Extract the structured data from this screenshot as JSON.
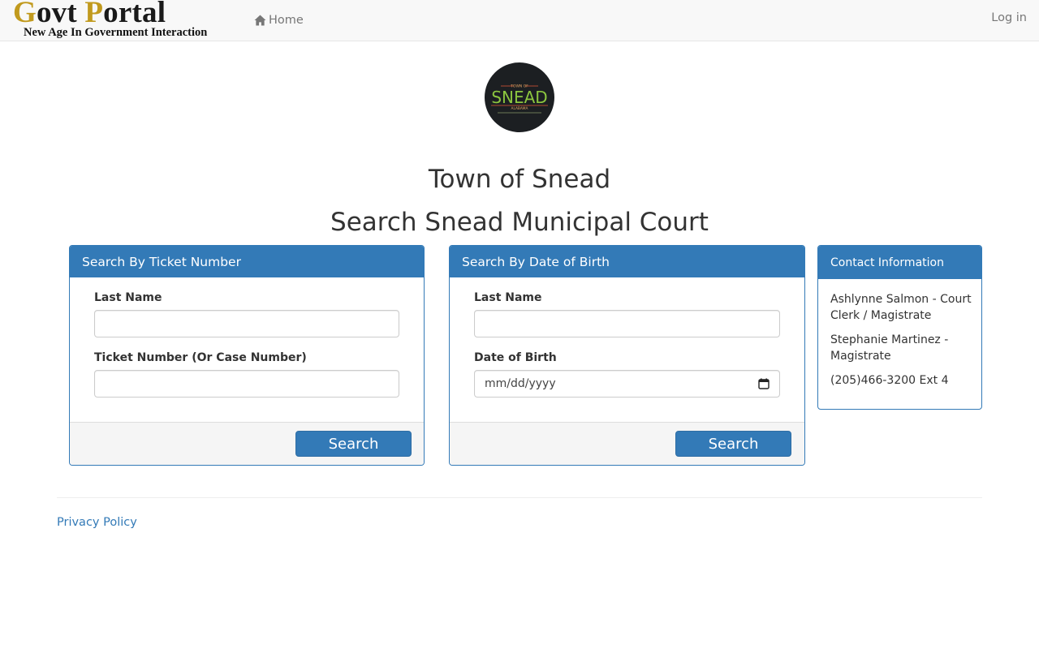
{
  "navbar": {
    "brand_initial_1": "G",
    "brand_rest_1": "ovt",
    "brand_initial_2": "P",
    "brand_rest_2": "ortal",
    "brand_tagline": "New Age In Government Interaction",
    "home_label": "Home",
    "login_label": "Log in"
  },
  "seal": {
    "top_text": "TOWN OF",
    "name": "SNEAD",
    "state": "ALABAMA"
  },
  "page": {
    "town_title": "Town of Snead",
    "court_title": "Search Snead Municipal Court"
  },
  "ticket_search": {
    "heading": "Search By Ticket Number",
    "last_name_label": "Last Name",
    "last_name_value": "",
    "ticket_label": "Ticket Number (Or Case Number)",
    "ticket_value": "",
    "search_label": "Search"
  },
  "dob_search": {
    "heading": "Search By Date of Birth",
    "last_name_label": "Last Name",
    "last_name_value": "",
    "dob_label": "Date of Birth",
    "dob_placeholder": "mm/dd/yyyy",
    "search_label": "Search"
  },
  "contact": {
    "heading": "Contact Information",
    "lines": [
      "Ashlynne Salmon - Court Clerk / Magistrate",
      "Stephanie Martinez - Magistrate",
      "(205)466-3200 Ext 4"
    ]
  },
  "footer": {
    "privacy_label": "Privacy Policy"
  },
  "colors": {
    "primary": "#337ab7",
    "brand_gold": "#c19a1e",
    "seal_green": "#8cc63f",
    "seal_background": "#1c1f22"
  },
  "icons": {
    "home": "home-icon",
    "calendar": "calendar-icon"
  }
}
